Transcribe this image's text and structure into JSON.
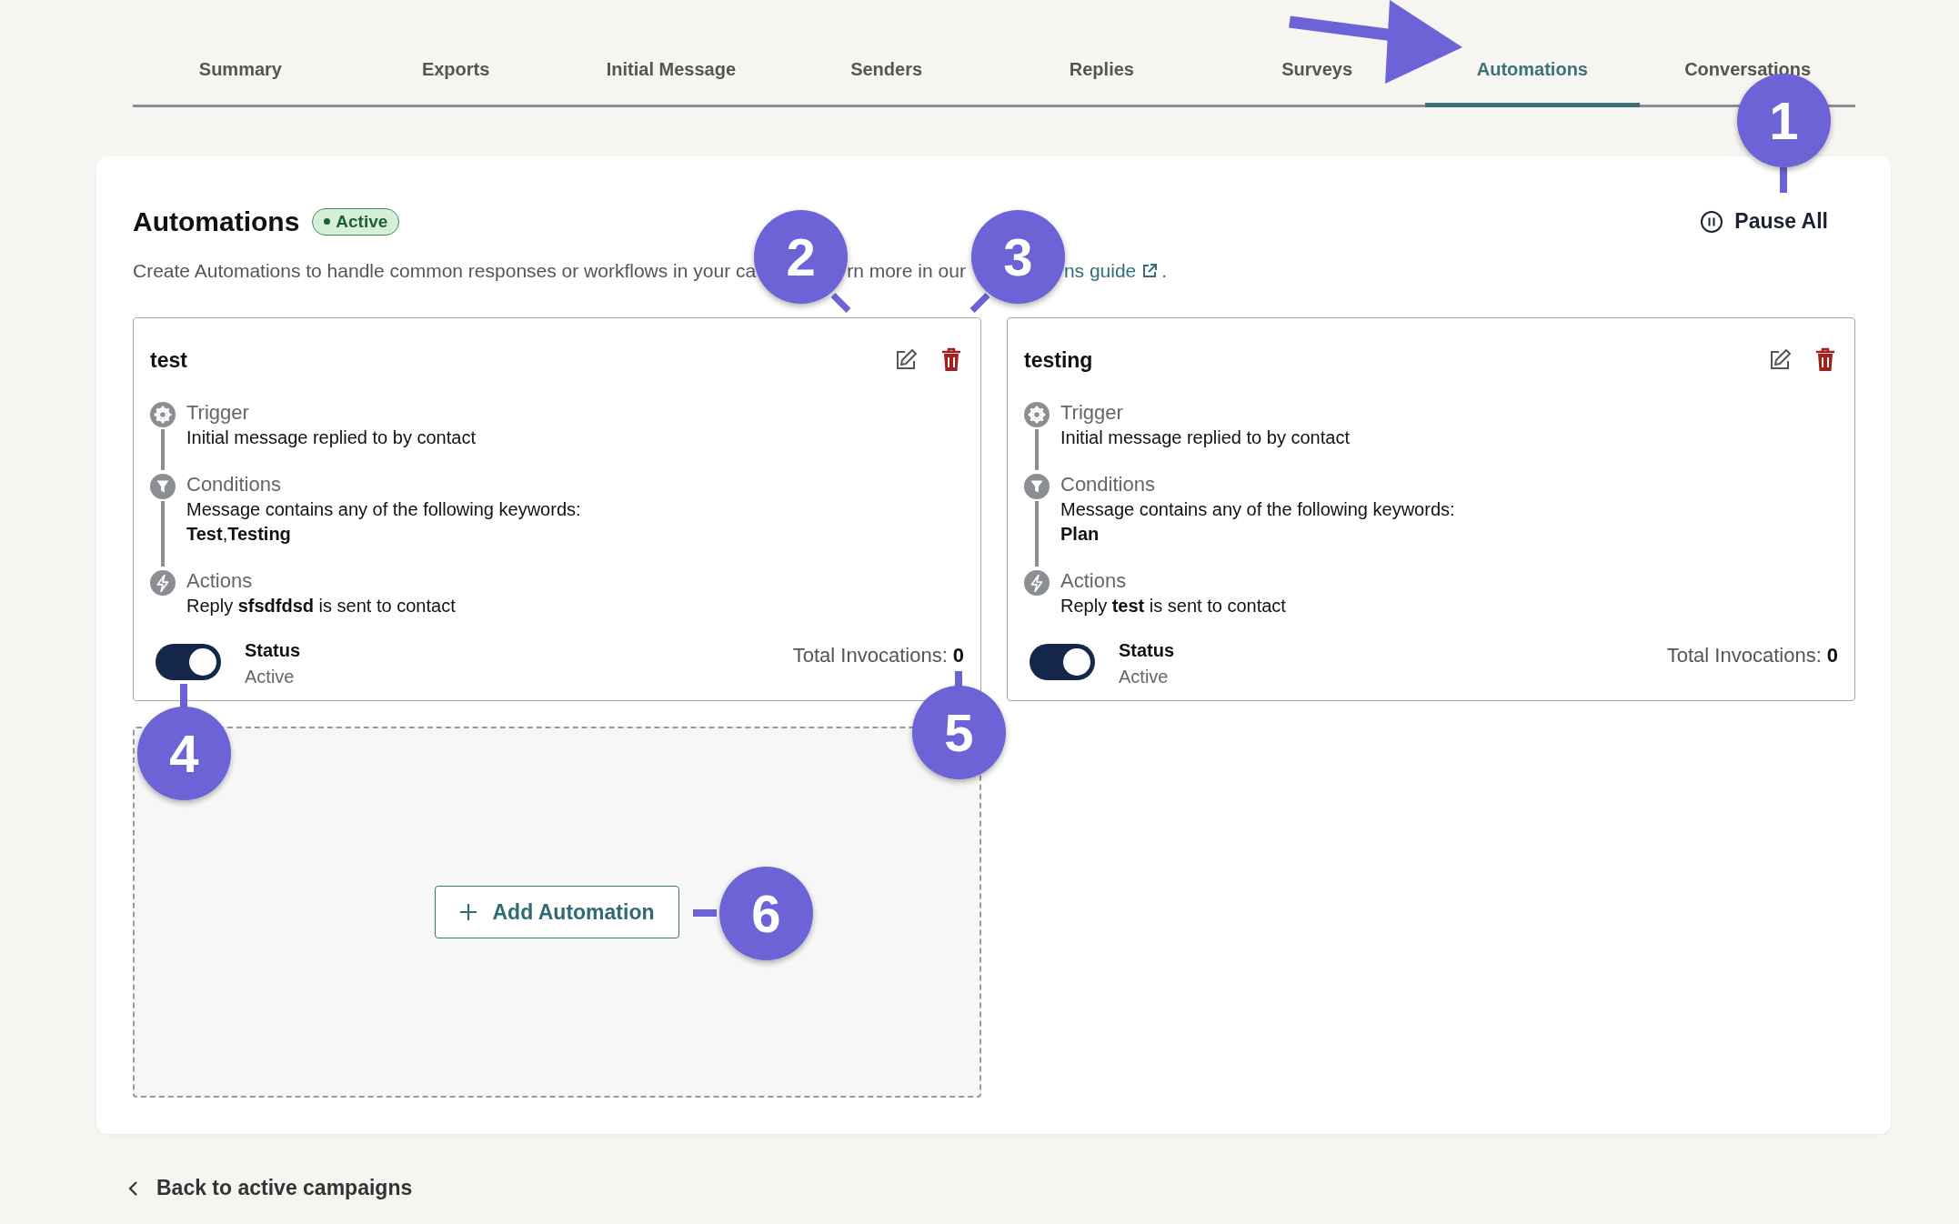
{
  "tabs": [
    {
      "label": "Summary",
      "selected": false
    },
    {
      "label": "Exports",
      "selected": false
    },
    {
      "label": "Initial Message",
      "selected": false
    },
    {
      "label": "Senders",
      "selected": false
    },
    {
      "label": "Replies",
      "selected": false
    },
    {
      "label": "Surveys",
      "selected": false
    },
    {
      "label": "Automations",
      "selected": true
    },
    {
      "label": "Conversations",
      "selected": false
    }
  ],
  "header": {
    "title": "Automations",
    "badge": "Active",
    "pause_button": "Pause All"
  },
  "description": {
    "parts": [
      "Create Automations to handle common responses or workflows in your ca",
      "rn more in our"
    ],
    "link": "ns guide",
    "end": "."
  },
  "automations": [
    {
      "name": "test",
      "steps": [
        {
          "kind": "trigger",
          "label": "Trigger",
          "lines": [
            "Initial message replied to by contact"
          ]
        },
        {
          "kind": "conditions",
          "label": "Conditions",
          "lines": [
            "Message contains any of the following keywords:",
            "**Test**,**Testing**"
          ]
        },
        {
          "kind": "actions",
          "label": "Actions",
          "lines": [
            "Reply **sfsdfdsd** is sent to contact"
          ]
        }
      ],
      "status_label": "Status",
      "status": "Active",
      "on": true,
      "invocations_label": "Total Invocations:",
      "invocations": "0"
    },
    {
      "name": "testing",
      "steps": [
        {
          "kind": "trigger",
          "label": "Trigger",
          "lines": [
            "Initial message replied to by contact"
          ]
        },
        {
          "kind": "conditions",
          "label": "Conditions",
          "lines": [
            "Message contains any of the following keywords:",
            "**Plan**"
          ]
        },
        {
          "kind": "actions",
          "label": "Actions",
          "lines": [
            "Reply **test** is sent to contact"
          ]
        }
      ],
      "status_label": "Status",
      "status": "Active",
      "on": true,
      "invocations_label": "Total Invocations:",
      "invocations": "0"
    }
  ],
  "add_button": "Add Automation",
  "back_link": "Back to active campaigns",
  "callouts": [
    "1",
    "2",
    "3",
    "4",
    "5",
    "6"
  ]
}
